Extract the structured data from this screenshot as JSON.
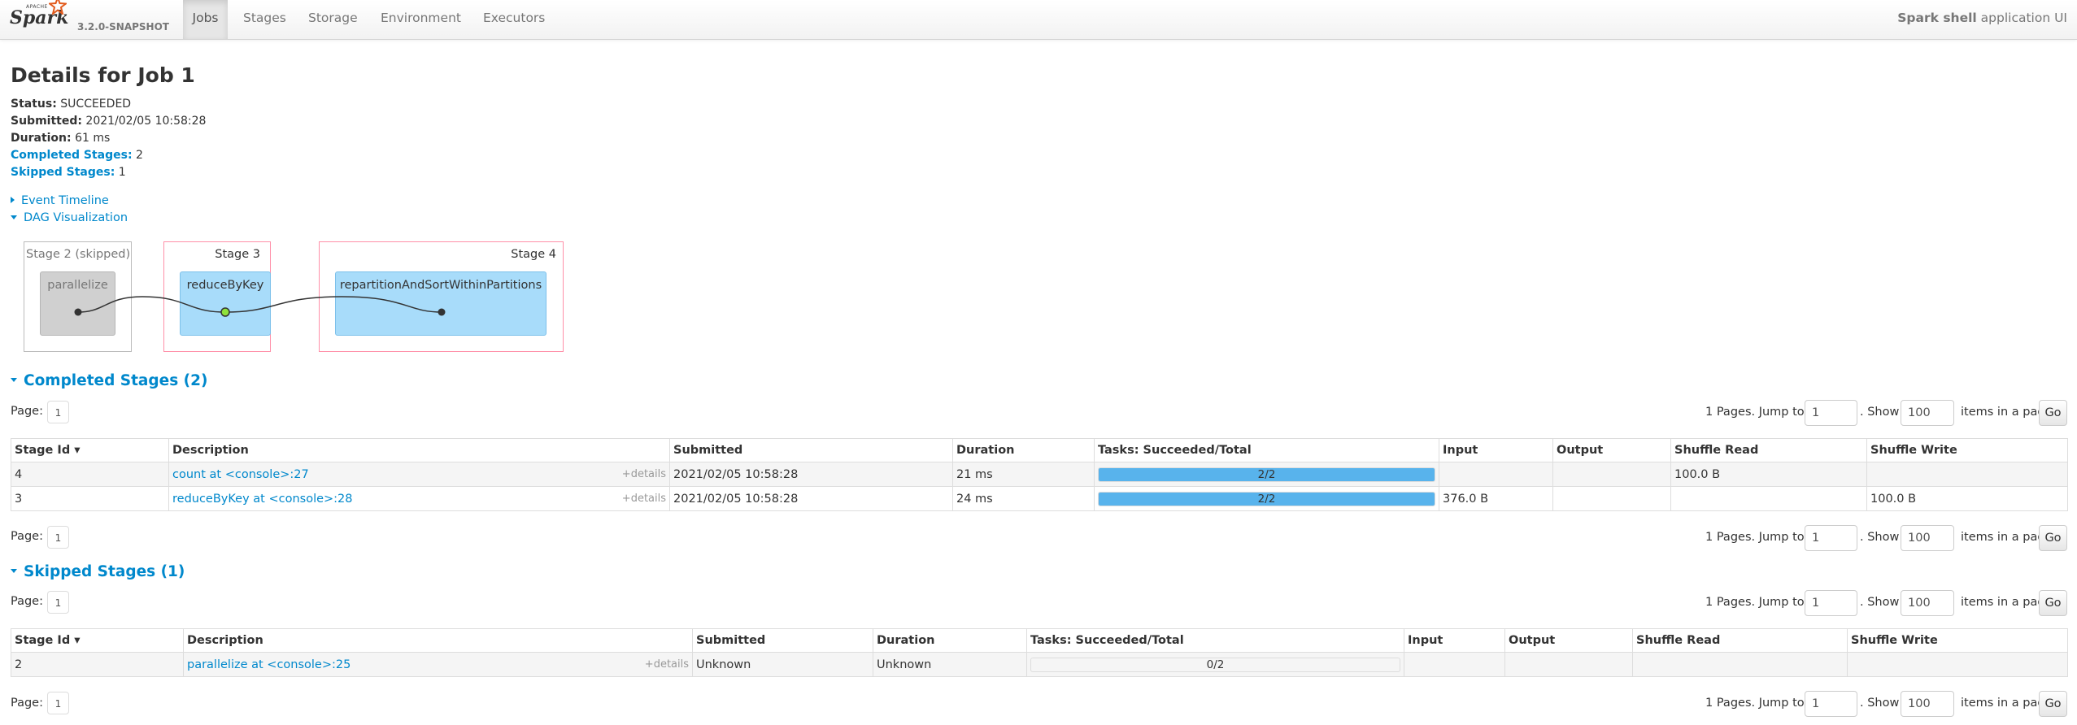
{
  "nav": {
    "brand_apache": "APACHE",
    "brand_spark": "Spark",
    "version": "3.2.0-SNAPSHOT",
    "tabs": [
      {
        "label": "Jobs",
        "active": true
      },
      {
        "label": "Stages",
        "active": false
      },
      {
        "label": "Storage",
        "active": false
      },
      {
        "label": "Environment",
        "active": false
      },
      {
        "label": "Executors",
        "active": false
      }
    ],
    "app_name": "Spark shell",
    "app_suffix": "application UI"
  },
  "job": {
    "title": "Details for Job 1",
    "status_label": "Status:",
    "status": "SUCCEEDED",
    "submitted_label": "Submitted:",
    "submitted": "2021/02/05 10:58:28",
    "duration_label": "Duration:",
    "duration": "61 ms",
    "completed_label": "Completed Stages:",
    "completed": "2",
    "skipped_label": "Skipped Stages:",
    "skipped": "1"
  },
  "toggles": {
    "event_timeline": "Event Timeline",
    "dag_visualization": "DAG Visualization"
  },
  "dag": {
    "stages": [
      {
        "label": "Stage 2 (skipped)",
        "node": "parallelize",
        "skipped": true
      },
      {
        "label": "Stage 3",
        "node": "reduceByKey",
        "skipped": false
      },
      {
        "label": "Stage 4",
        "node": "repartitionAndSortWithinPartitions",
        "skipped": false
      }
    ]
  },
  "pagination": {
    "page_label": "Page:",
    "page_value": "1",
    "pages_text": "1 Pages. Jump to",
    "jump_value": "1",
    "show_text": ". Show",
    "show_value": "100",
    "items_text": "items in a page.",
    "go_label": "Go"
  },
  "completed_stages": {
    "title": "Completed Stages (2)",
    "headers": [
      "Stage Id ▾",
      "Description",
      "Submitted",
      "Duration",
      "Tasks: Succeeded/Total",
      "Input",
      "Output",
      "Shuffle Read",
      "Shuffle Write"
    ],
    "details_label": "+details",
    "rows": [
      {
        "id": "4",
        "desc": "count at <console>:27",
        "submitted": "2021/02/05 10:58:28",
        "duration": "21 ms",
        "tasks": "2/2",
        "progress": 1.0,
        "input": "",
        "output": "",
        "shuffle_read": "100.0 B",
        "shuffle_write": ""
      },
      {
        "id": "3",
        "desc": "reduceByKey at <console>:28",
        "submitted": "2021/02/05 10:58:28",
        "duration": "24 ms",
        "tasks": "2/2",
        "progress": 1.0,
        "input": "376.0 B",
        "output": "",
        "shuffle_read": "",
        "shuffle_write": "100.0 B"
      }
    ]
  },
  "skipped_stages": {
    "title": "Skipped Stages (1)",
    "headers": [
      "Stage Id ▾",
      "Description",
      "Submitted",
      "Duration",
      "Tasks: Succeeded/Total",
      "Input",
      "Output",
      "Shuffle Read",
      "Shuffle Write"
    ],
    "details_label": "+details",
    "rows": [
      {
        "id": "2",
        "desc": "parallelize at <console>:25",
        "submitted": "Unknown",
        "duration": "Unknown",
        "tasks": "0/2",
        "progress": 0.0,
        "input": "",
        "output": "",
        "shuffle_read": "",
        "shuffle_write": ""
      }
    ]
  },
  "colors": {
    "link": "#0088cc",
    "progress_fill": "#58b3ec",
    "stage_border": "#ff8fa8",
    "dag_node_blue": "#a8dcfa",
    "dag_node_grey": "#d0d0d0",
    "cached_dot": "#8fe23a"
  }
}
